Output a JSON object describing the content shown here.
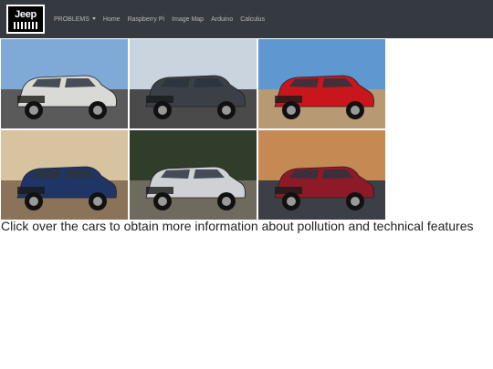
{
  "brand": {
    "logo_text": "Jeep"
  },
  "nav": {
    "items": [
      {
        "label": "PROBLEMS",
        "dropdown": true
      },
      {
        "label": "Home"
      },
      {
        "label": "Raspberry Pi"
      },
      {
        "label": "Image Map"
      },
      {
        "label": "Arduino"
      },
      {
        "label": "Calculus"
      }
    ]
  },
  "gallery": {
    "tiles": [
      {
        "car_color": "#d9d9d6",
        "sky": "#7fa9d6",
        "ground": "#5a5a5a"
      },
      {
        "car_color": "#3b3f46",
        "sky": "#c9d4df",
        "ground": "#4a4a4a"
      },
      {
        "car_color": "#c8161c",
        "sky": "#5f97d1",
        "ground": "#b79a73"
      },
      {
        "car_color": "#1f3566",
        "sky": "#d8c3a0",
        "ground": "#8a7358"
      },
      {
        "car_color": "#cfd2d4",
        "sky": "#2f3d2a",
        "ground": "#6e6a5e"
      },
      {
        "car_color": "#8d1a26",
        "sky": "#c58a54",
        "ground": "#3c3f46"
      }
    ]
  },
  "caption": "Click over the cars to obtain more information about pollution and technical features"
}
